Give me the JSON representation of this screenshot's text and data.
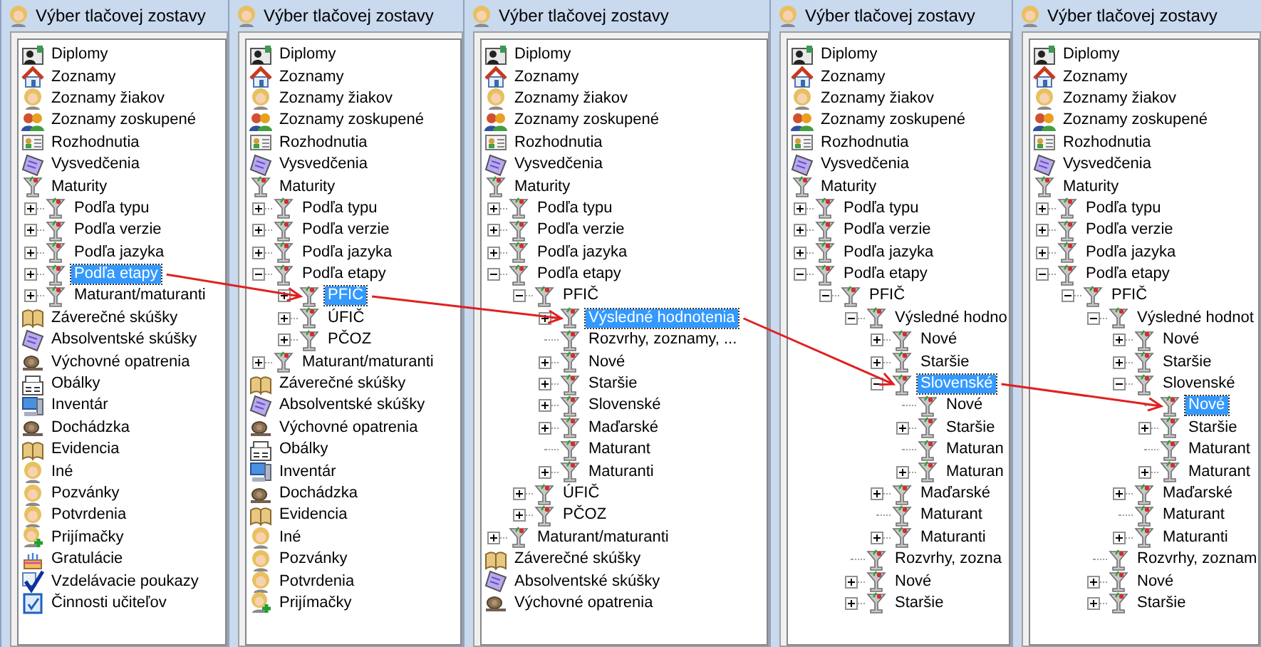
{
  "windows": [
    {
      "title": "Výber tlačovej zostavy",
      "tree": [
        {
          "label": "Diplomy",
          "kind": "diploma",
          "selected": false
        },
        {
          "label": "Zoznamy",
          "kind": "house",
          "selected": false
        },
        {
          "label": "Zoznamy žiakov",
          "kind": "person",
          "selected": false
        },
        {
          "label": "Zoznamy zoskupené",
          "kind": "group",
          "selected": false
        },
        {
          "label": "Rozhodnutia",
          "kind": "card",
          "selected": false
        },
        {
          "label": "Vysvedčenia",
          "kind": "certificate",
          "selected": false
        },
        {
          "label": "Maturity",
          "kind": "goblet",
          "selected": false,
          "children": [
            {
              "label": "Podľa typu",
              "kind": "goblet",
              "selected": false,
              "expanded": false
            },
            {
              "label": "Podľa verzie",
              "kind": "goblet",
              "selected": false,
              "expanded": false
            },
            {
              "label": "Podľa jazyka",
              "kind": "goblet",
              "selected": false,
              "expanded": false
            },
            {
              "label": "Podľa etapy",
              "kind": "goblet",
              "selected": true,
              "expanded": false
            },
            {
              "label": "Maturant/maturanti",
              "kind": "goblet",
              "selected": false,
              "expanded": false
            }
          ]
        },
        {
          "label": "Záverečné skúšky",
          "kind": "book",
          "selected": false
        },
        {
          "label": "Absolventské skúšky",
          "kind": "certificate",
          "selected": false
        },
        {
          "label": "Výchovné opatrenia",
          "kind": "snail",
          "selected": false
        },
        {
          "label": "Obálky",
          "kind": "envelope",
          "selected": false
        },
        {
          "label": "Inventár",
          "kind": "computer",
          "selected": false
        },
        {
          "label": "Dochádzka",
          "kind": "snail",
          "selected": false
        },
        {
          "label": "Evidencia",
          "kind": "book",
          "selected": false
        },
        {
          "label": "Iné",
          "kind": "person",
          "selected": false
        },
        {
          "label": "Pozvánky",
          "kind": "person",
          "selected": false
        },
        {
          "label": "Potvrdenia",
          "kind": "person",
          "selected": false
        },
        {
          "label": "Prijímačky",
          "kind": "person_plus",
          "selected": false
        },
        {
          "label": "Gratulácie",
          "kind": "cake",
          "selected": false
        },
        {
          "label": "Vzdelávacie poukazy",
          "kind": "check",
          "selected": false
        },
        {
          "label": "Činnosti učiteľov",
          "kind": "clipboard",
          "selected": false
        }
      ]
    },
    {
      "title": "Výber tlačovej zostavy",
      "tree": [
        {
          "label": "Diplomy",
          "kind": "diploma",
          "selected": false
        },
        {
          "label": "Zoznamy",
          "kind": "house",
          "selected": false
        },
        {
          "label": "Zoznamy žiakov",
          "kind": "person",
          "selected": false
        },
        {
          "label": "Zoznamy zoskupené",
          "kind": "group",
          "selected": false
        },
        {
          "label": "Rozhodnutia",
          "kind": "card",
          "selected": false
        },
        {
          "label": "Vysvedčenia",
          "kind": "certificate",
          "selected": false
        },
        {
          "label": "Maturity",
          "kind": "goblet",
          "selected": false,
          "children": [
            {
              "label": "Podľa typu",
              "kind": "goblet",
              "selected": false,
              "expanded": false
            },
            {
              "label": "Podľa verzie",
              "kind": "goblet",
              "selected": false,
              "expanded": false
            },
            {
              "label": "Podľa jazyka",
              "kind": "goblet",
              "selected": false,
              "expanded": false
            },
            {
              "label": "Podľa etapy",
              "kind": "goblet",
              "selected": false,
              "expanded": true,
              "children": [
                {
                  "label": "PFIČ",
                  "kind": "goblet",
                  "selected": true,
                  "expanded": false
                },
                {
                  "label": "ÚFIČ",
                  "kind": "goblet",
                  "selected": false,
                  "expanded": false
                },
                {
                  "label": "PČOZ",
                  "kind": "goblet",
                  "selected": false,
                  "expanded": false
                }
              ]
            },
            {
              "label": "Maturant/maturanti",
              "kind": "goblet",
              "selected": false,
              "expanded": false
            }
          ]
        },
        {
          "label": "Záverečné skúšky",
          "kind": "book",
          "selected": false
        },
        {
          "label": "Absolventské skúšky",
          "kind": "certificate",
          "selected": false
        },
        {
          "label": "Výchovné opatrenia",
          "kind": "snail",
          "selected": false
        },
        {
          "label": "Obálky",
          "kind": "envelope",
          "selected": false
        },
        {
          "label": "Inventár",
          "kind": "computer",
          "selected": false
        },
        {
          "label": "Dochádzka",
          "kind": "snail",
          "selected": false
        },
        {
          "label": "Evidencia",
          "kind": "book",
          "selected": false
        },
        {
          "label": "Iné",
          "kind": "person",
          "selected": false
        },
        {
          "label": "Pozvánky",
          "kind": "person",
          "selected": false
        },
        {
          "label": "Potvrdenia",
          "kind": "person",
          "selected": false
        },
        {
          "label": "Prijímačky",
          "kind": "person_plus",
          "selected": false
        }
      ]
    },
    {
      "title": "Výber tlačovej zostavy",
      "tree": [
        {
          "label": "Diplomy",
          "kind": "diploma",
          "selected": false
        },
        {
          "label": "Zoznamy",
          "kind": "house",
          "selected": false
        },
        {
          "label": "Zoznamy žiakov",
          "kind": "person",
          "selected": false
        },
        {
          "label": "Zoznamy zoskupené",
          "kind": "group",
          "selected": false
        },
        {
          "label": "Rozhodnutia",
          "kind": "card",
          "selected": false
        },
        {
          "label": "Vysvedčenia",
          "kind": "certificate",
          "selected": false
        },
        {
          "label": "Maturity",
          "kind": "goblet",
          "selected": false,
          "children": [
            {
              "label": "Podľa typu",
              "kind": "goblet",
              "selected": false,
              "expanded": false
            },
            {
              "label": "Podľa verzie",
              "kind": "goblet",
              "selected": false,
              "expanded": false
            },
            {
              "label": "Podľa jazyka",
              "kind": "goblet",
              "selected": false,
              "expanded": false
            },
            {
              "label": "Podľa etapy",
              "kind": "goblet",
              "selected": false,
              "expanded": true,
              "children": [
                {
                  "label": "PFIČ",
                  "kind": "goblet",
                  "selected": false,
                  "expanded": true,
                  "children": [
                    {
                      "label": "Výsledné hodnotenia",
                      "kind": "goblet",
                      "selected": true,
                      "expanded": false
                    },
                    {
                      "label": "Rozvrhy, zoznamy, ...",
                      "kind": "goblet",
                      "selected": false
                    },
                    {
                      "label": "Nové",
                      "kind": "goblet",
                      "selected": false,
                      "expanded": false
                    },
                    {
                      "label": "Staršie",
                      "kind": "goblet",
                      "selected": false,
                      "expanded": false
                    },
                    {
                      "label": "Slovenské",
                      "kind": "goblet",
                      "selected": false,
                      "expanded": false
                    },
                    {
                      "label": "Maďarské",
                      "kind": "goblet",
                      "selected": false,
                      "expanded": false
                    },
                    {
                      "label": "Maturant",
                      "kind": "goblet",
                      "selected": false
                    },
                    {
                      "label": "Maturanti",
                      "kind": "goblet",
                      "selected": false,
                      "expanded": false
                    }
                  ]
                },
                {
                  "label": "ÚFIČ",
                  "kind": "goblet",
                  "selected": false,
                  "expanded": false
                },
                {
                  "label": "PČOZ",
                  "kind": "goblet",
                  "selected": false,
                  "expanded": false
                }
              ]
            },
            {
              "label": "Maturant/maturanti",
              "kind": "goblet",
              "selected": false,
              "expanded": false
            }
          ]
        },
        {
          "label": "Záverečné skúšky",
          "kind": "book",
          "selected": false
        },
        {
          "label": "Absolventské skúšky",
          "kind": "certificate",
          "selected": false
        },
        {
          "label": "Výchovné opatrenia",
          "kind": "snail",
          "selected": false
        }
      ]
    },
    {
      "title": "Výber tlačovej zostavy",
      "tree": [
        {
          "label": "Diplomy",
          "kind": "diploma",
          "selected": false
        },
        {
          "label": "Zoznamy",
          "kind": "house",
          "selected": false
        },
        {
          "label": "Zoznamy žiakov",
          "kind": "person",
          "selected": false
        },
        {
          "label": "Zoznamy zoskupené",
          "kind": "group",
          "selected": false
        },
        {
          "label": "Rozhodnutia",
          "kind": "card",
          "selected": false
        },
        {
          "label": "Vysvedčenia",
          "kind": "certificate",
          "selected": false
        },
        {
          "label": "Maturity",
          "kind": "goblet",
          "selected": false,
          "children": [
            {
              "label": "Podľa typu",
              "kind": "goblet",
              "selected": false,
              "expanded": false
            },
            {
              "label": "Podľa verzie",
              "kind": "goblet",
              "selected": false,
              "expanded": false
            },
            {
              "label": "Podľa jazyka",
              "kind": "goblet",
              "selected": false,
              "expanded": false
            },
            {
              "label": "Podľa etapy",
              "kind": "goblet",
              "selected": false,
              "expanded": true,
              "children": [
                {
                  "label": "PFIČ",
                  "kind": "goblet",
                  "selected": false,
                  "expanded": true,
                  "children": [
                    {
                      "label": "Výsledné hodno",
                      "kind": "goblet",
                      "selected": false,
                      "expanded": true,
                      "children": [
                        {
                          "label": "Nové",
                          "kind": "goblet",
                          "selected": false,
                          "expanded": false
                        },
                        {
                          "label": "Staršie",
                          "kind": "goblet",
                          "selected": false,
                          "expanded": false
                        },
                        {
                          "label": "Slovenské",
                          "kind": "goblet",
                          "selected": true,
                          "expanded": true,
                          "children": [
                            {
                              "label": "Nové",
                              "kind": "goblet",
                              "selected": false
                            },
                            {
                              "label": "Staršie",
                              "kind": "goblet",
                              "selected": false,
                              "expanded": false
                            },
                            {
                              "label": "Maturan",
                              "kind": "goblet",
                              "selected": false
                            },
                            {
                              "label": "Maturan",
                              "kind": "goblet",
                              "selected": false,
                              "expanded": false
                            }
                          ]
                        },
                        {
                          "label": "Maďarské",
                          "kind": "goblet",
                          "selected": false,
                          "expanded": false
                        },
                        {
                          "label": "Maturant",
                          "kind": "goblet",
                          "selected": false
                        },
                        {
                          "label": "Maturanti",
                          "kind": "goblet",
                          "selected": false,
                          "expanded": false
                        }
                      ]
                    },
                    {
                      "label": "Rozvrhy, zozna",
                      "kind": "goblet",
                      "selected": false
                    },
                    {
                      "label": "Nové",
                      "kind": "goblet",
                      "selected": false,
                      "expanded": false
                    },
                    {
                      "label": "Staršie",
                      "kind": "goblet",
                      "selected": false,
                      "expanded": false
                    }
                  ]
                }
              ]
            }
          ]
        }
      ]
    },
    {
      "title": "Výber tlačovej zostavy",
      "tree": [
        {
          "label": "Diplomy",
          "kind": "diploma",
          "selected": false
        },
        {
          "label": "Zoznamy",
          "kind": "house",
          "selected": false
        },
        {
          "label": "Zoznamy žiakov",
          "kind": "person",
          "selected": false
        },
        {
          "label": "Zoznamy zoskupené",
          "kind": "group",
          "selected": false
        },
        {
          "label": "Rozhodnutia",
          "kind": "card",
          "selected": false
        },
        {
          "label": "Vysvedčenia",
          "kind": "certificate",
          "selected": false
        },
        {
          "label": "Maturity",
          "kind": "goblet",
          "selected": false,
          "children": [
            {
              "label": "Podľa typu",
              "kind": "goblet",
              "selected": false,
              "expanded": false
            },
            {
              "label": "Podľa verzie",
              "kind": "goblet",
              "selected": false,
              "expanded": false
            },
            {
              "label": "Podľa jazyka",
              "kind": "goblet",
              "selected": false,
              "expanded": false
            },
            {
              "label": "Podľa etapy",
              "kind": "goblet",
              "selected": false,
              "expanded": true,
              "children": [
                {
                  "label": "PFIČ",
                  "kind": "goblet",
                  "selected": false,
                  "expanded": true,
                  "children": [
                    {
                      "label": "Výsledné hodnot",
                      "kind": "goblet",
                      "selected": false,
                      "expanded": true,
                      "children": [
                        {
                          "label": "Nové",
                          "kind": "goblet",
                          "selected": false,
                          "expanded": false
                        },
                        {
                          "label": "Staršie",
                          "kind": "goblet",
                          "selected": false,
                          "expanded": false
                        },
                        {
                          "label": "Slovenské",
                          "kind": "goblet",
                          "selected": false,
                          "expanded": true,
                          "children": [
                            {
                              "label": "Nové",
                              "kind": "goblet",
                              "selected": true
                            },
                            {
                              "label": "Staršie",
                              "kind": "goblet",
                              "selected": false,
                              "expanded": false
                            },
                            {
                              "label": "Maturant",
                              "kind": "goblet",
                              "selected": false
                            },
                            {
                              "label": "Maturant",
                              "kind": "goblet",
                              "selected": false,
                              "expanded": false
                            }
                          ]
                        },
                        {
                          "label": "Maďarské",
                          "kind": "goblet",
                          "selected": false,
                          "expanded": false
                        },
                        {
                          "label": "Maturant",
                          "kind": "goblet",
                          "selected": false
                        },
                        {
                          "label": "Maturanti",
                          "kind": "goblet",
                          "selected": false,
                          "expanded": false
                        }
                      ]
                    },
                    {
                      "label": "Rozvrhy, zoznam",
                      "kind": "goblet",
                      "selected": false
                    },
                    {
                      "label": "Nové",
                      "kind": "goblet",
                      "selected": false,
                      "expanded": false
                    },
                    {
                      "label": "Staršie",
                      "kind": "goblet",
                      "selected": false,
                      "expanded": false
                    }
                  ]
                }
              ]
            }
          ]
        }
      ]
    }
  ]
}
